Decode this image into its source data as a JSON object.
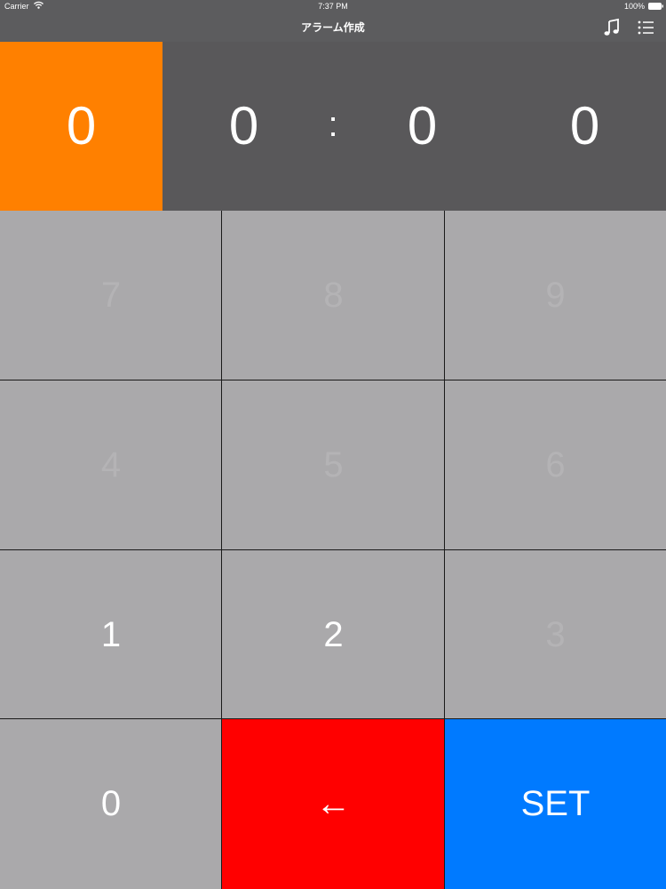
{
  "status_bar": {
    "carrier": "Carrier",
    "time": "7:37 PM",
    "battery": "100%"
  },
  "nav_bar": {
    "title": "アラーム作成",
    "icons": [
      "music-note-icon",
      "list-icon"
    ]
  },
  "display": {
    "digits": [
      "0",
      "0",
      "0",
      "0"
    ],
    "separator": ":",
    "active_digit_index": 0,
    "active_color": "#ff8000"
  },
  "keypad": {
    "rows": [
      [
        "7",
        "8",
        "9"
      ],
      [
        "4",
        "5",
        "6"
      ],
      [
        "1",
        "2",
        "3"
      ],
      [
        "0",
        "←",
        "SET"
      ]
    ],
    "enabled_keys": [
      "1",
      "2",
      "0",
      "←",
      "SET"
    ],
    "backspace_color": "#ff0000",
    "set_color": "#007aff"
  }
}
